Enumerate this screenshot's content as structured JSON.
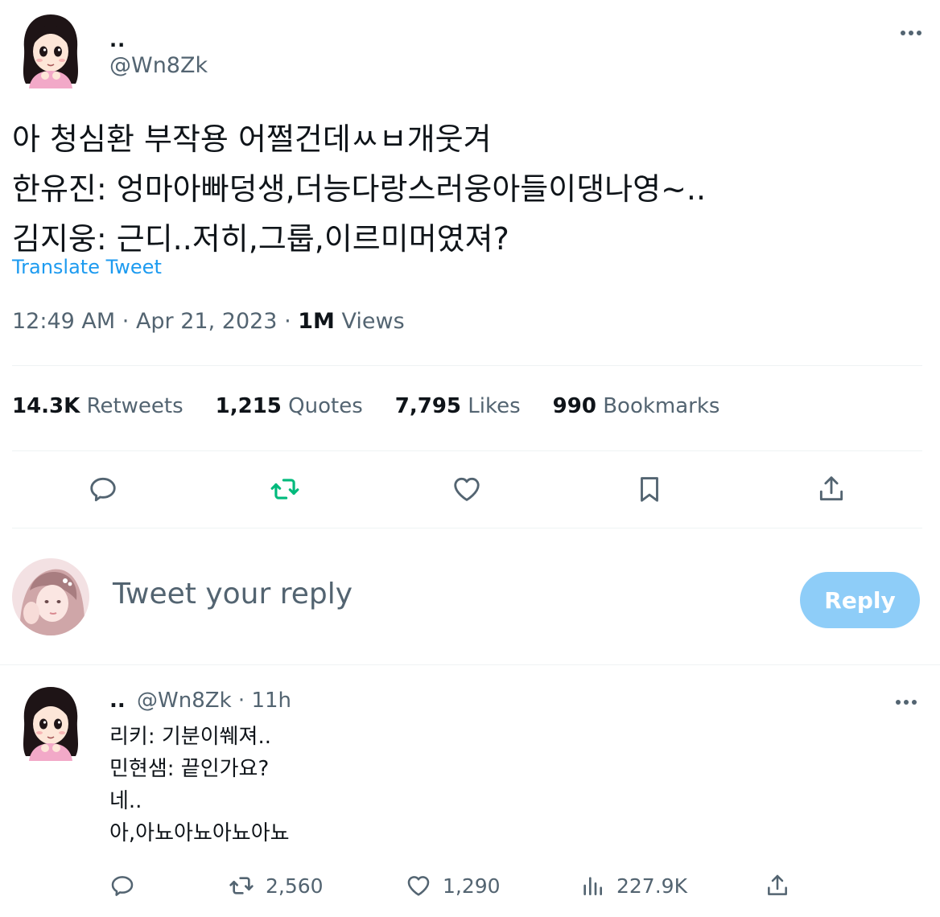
{
  "tweet": {
    "display_name": "..",
    "handle": "@Wn8Zk",
    "lines": [
      "아 청심환 부작용 어쩔건데ㅆㅂ개웃겨",
      "한유진: 엉마아빠덩생,더능다랑스러웅아들이댕나영~..",
      "김지웅: 근디..저히,그룹,이르미머였져?"
    ],
    "translate_label": "Translate Tweet",
    "time": "12:49 AM",
    "date": "Apr 21, 2023",
    "views_count": "1M",
    "views_label": "Views",
    "separator": "·"
  },
  "stats": {
    "retweets_count": "14.3K",
    "retweets_label": "Retweets",
    "quotes_count": "1,215",
    "quotes_label": "Quotes",
    "likes_count": "7,795",
    "likes_label": "Likes",
    "bookmarks_count": "990",
    "bookmarks_label": "Bookmarks"
  },
  "action_icons": [
    "reply-icon",
    "retweet-icon",
    "like-icon",
    "bookmark-icon",
    "share-icon"
  ],
  "composer": {
    "placeholder": "Tweet your reply",
    "reply_button": "Reply"
  },
  "reply": {
    "display_name": "..",
    "handle": "@Wn8Zk",
    "separator": "·",
    "age": "11h",
    "lines": [
      "리키: 기분이쒜져..",
      "민현샘: 끝인가요?",
      "네..",
      "아,아뇨아뇨아뇨아뇨"
    ],
    "retweets": "2,560",
    "likes": "1,290",
    "views": "227.9K"
  },
  "colors": {
    "text": "#0f1419",
    "secondary": "#536471",
    "accent": "#1d9bf0",
    "retweet_green": "#00ba7c",
    "reply_button_disabled": "#8ecdf8",
    "divider": "#eff3f4"
  }
}
